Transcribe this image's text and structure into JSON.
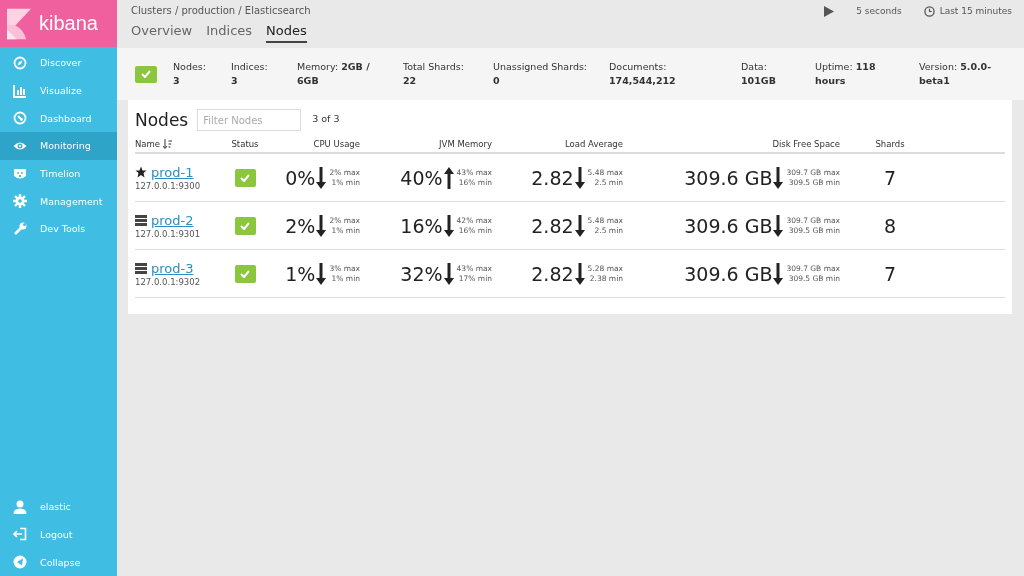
{
  "logo": {
    "text": "kibana"
  },
  "sidebar": {
    "items": [
      {
        "label": "Discover",
        "selected": false
      },
      {
        "label": "Visualize",
        "selected": false
      },
      {
        "label": "Dashboard",
        "selected": false
      },
      {
        "label": "Monitoring",
        "selected": true
      },
      {
        "label": "Timelion",
        "selected": false
      },
      {
        "label": "Management",
        "selected": false
      },
      {
        "label": "Dev Tools",
        "selected": false
      }
    ],
    "bottom_items": [
      {
        "label": "elastic"
      },
      {
        "label": "Logout"
      },
      {
        "label": "Collapse"
      }
    ]
  },
  "breadcrumb": "Clusters / production / Elasticsearch",
  "tabs": [
    {
      "label": "Overview",
      "selected": false
    },
    {
      "label": "Indices",
      "selected": false
    },
    {
      "label": "Nodes",
      "selected": true
    }
  ],
  "refresh": {
    "interval": "5 seconds",
    "time_range": "Last 15 minutes"
  },
  "cluster_healthy": true,
  "stats": [
    "Nodes: **3**",
    "Indices: **3**",
    "Memory: **2GB / 6GB**",
    "Total Shards: **22**",
    "Unassigned Shards: **0**",
    "Documents: **174,544,212**",
    "Data: **101GB**",
    "Uptime: **118 hours**",
    "Version: **5.0.0-beta1**"
  ],
  "nodes_panel": {
    "title": "Nodes",
    "filter": {
      "placeholder": "Filter Nodes"
    },
    "count": "3 of 3",
    "columns": [
      "Name",
      "Status",
      "CPU Usage",
      "JVM Memory",
      "Load Average",
      "Disk Free Space",
      "Shards"
    ],
    "rows": [
      {
        "kind": "master",
        "name": "prod-1",
        "address": "127.0.0.1:9300",
        "healthy": true,
        "metrics": [
          {
            "value": "0%",
            "rising": false,
            "max": "2% max",
            "min": "1% min"
          },
          {
            "value": "40%",
            "rising": true,
            "max": "43% max",
            "min": "16% min"
          },
          {
            "value": "2.82",
            "rising": false,
            "max": "5.48 max",
            "min": "2.5 min"
          },
          {
            "value": "309.6 GB",
            "rising": false,
            "max": "309.7 GB max",
            "min": "309.5 GB min"
          }
        ],
        "shards": "7"
      },
      {
        "kind": "data",
        "name": "prod-2",
        "address": "127.0.0.1:9301",
        "healthy": true,
        "metrics": [
          {
            "value": "2%",
            "rising": false,
            "max": "2% max",
            "min": "1% min"
          },
          {
            "value": "16%",
            "rising": false,
            "max": "42% max",
            "min": "16% min"
          },
          {
            "value": "2.82",
            "rising": false,
            "max": "5.48 max",
            "min": "2.5 min"
          },
          {
            "value": "309.6 GB",
            "rising": false,
            "max": "309.7 GB max",
            "min": "309.5 GB min"
          }
        ],
        "shards": "8"
      },
      {
        "kind": "data",
        "name": "prod-3",
        "address": "127.0.0.1:9302",
        "healthy": true,
        "metrics": [
          {
            "value": "1%",
            "rising": false,
            "max": "3% max",
            "min": "1% min"
          },
          {
            "value": "32%",
            "rising": false,
            "max": "43% max",
            "min": "17% min"
          },
          {
            "value": "2.82",
            "rising": false,
            "max": "5.28 max",
            "min": "2.38 min"
          },
          {
            "value": "309.6 GB",
            "rising": false,
            "max": "309.7 GB max",
            "min": "309.5 GB min"
          }
        ],
        "shards": "7"
      }
    ]
  }
}
